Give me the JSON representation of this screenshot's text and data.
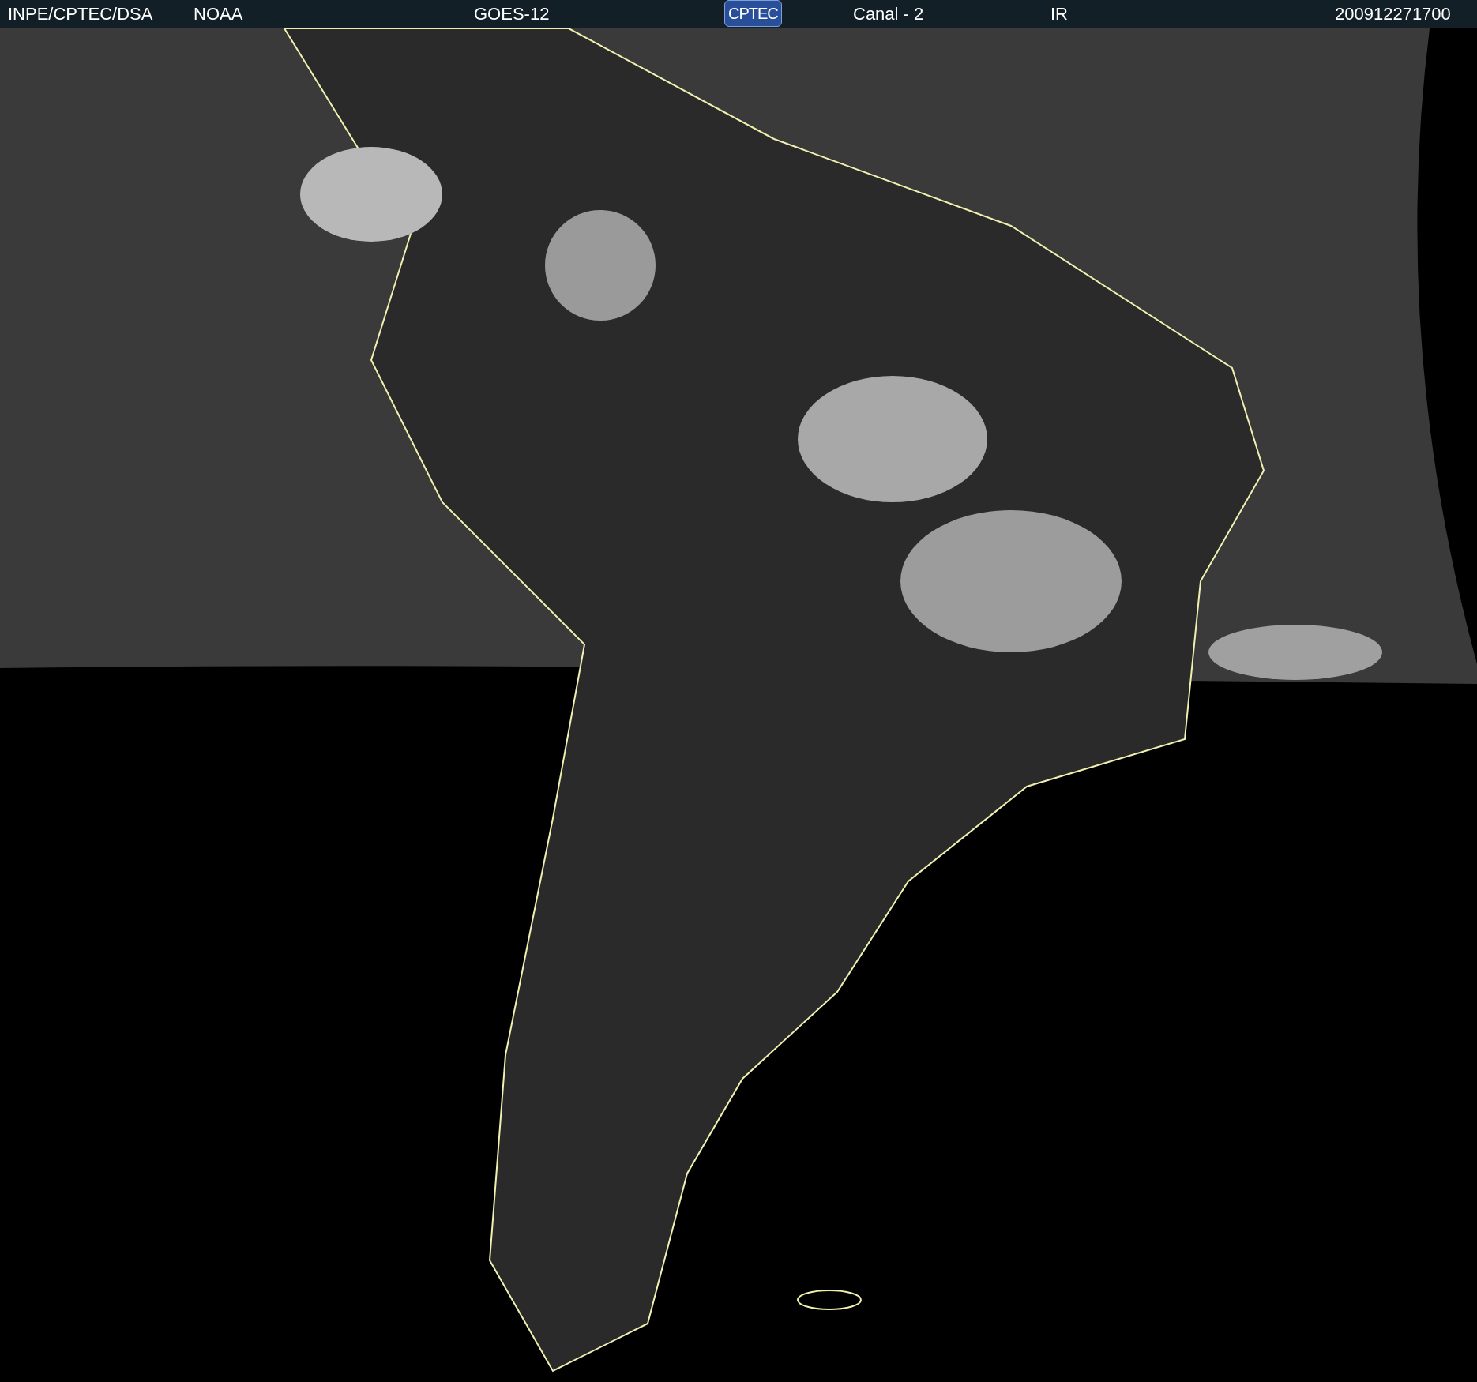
{
  "header": {
    "items": [
      {
        "kind": "text",
        "text": "INPE/CPTEC/DSA"
      },
      {
        "kind": "text",
        "text": "NOAA"
      },
      {
        "kind": "text",
        "text": "GOES-12"
      },
      {
        "kind": "logo",
        "text": "CPTEC"
      },
      {
        "kind": "text",
        "text": "Canal - 2"
      },
      {
        "kind": "text",
        "text": "IR"
      },
      {
        "kind": "text",
        "text": "200912271700"
      }
    ]
  }
}
